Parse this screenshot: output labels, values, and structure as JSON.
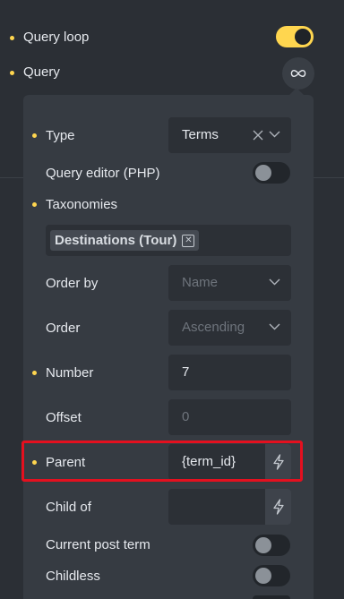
{
  "top": {
    "query_loop_label": "Query loop",
    "query_label": "Query",
    "query_loop_enabled": true
  },
  "popup": {
    "type": {
      "label": "Type",
      "value": "Terms"
    },
    "query_editor": {
      "label": "Query editor (PHP)",
      "enabled": false
    },
    "taxonomies": {
      "label": "Taxonomies",
      "chips": [
        "Destinations (Tour)"
      ]
    },
    "order_by": {
      "label": "Order by",
      "placeholder": "Name"
    },
    "order": {
      "label": "Order",
      "placeholder": "Ascending"
    },
    "number": {
      "label": "Number",
      "value": "7"
    },
    "offset": {
      "label": "Offset",
      "placeholder": "0"
    },
    "parent": {
      "label": "Parent",
      "value": "{term_id}"
    },
    "child_of": {
      "label": "Child of",
      "value": ""
    },
    "current_post_term": {
      "label": "Current post term",
      "enabled": false
    },
    "childless": {
      "label": "Childless",
      "enabled": false
    }
  },
  "colors": {
    "accent": "#ffd64f",
    "highlight": "#e4101f",
    "panel_bg": "#2b2f35",
    "popup_bg": "#363b42"
  }
}
